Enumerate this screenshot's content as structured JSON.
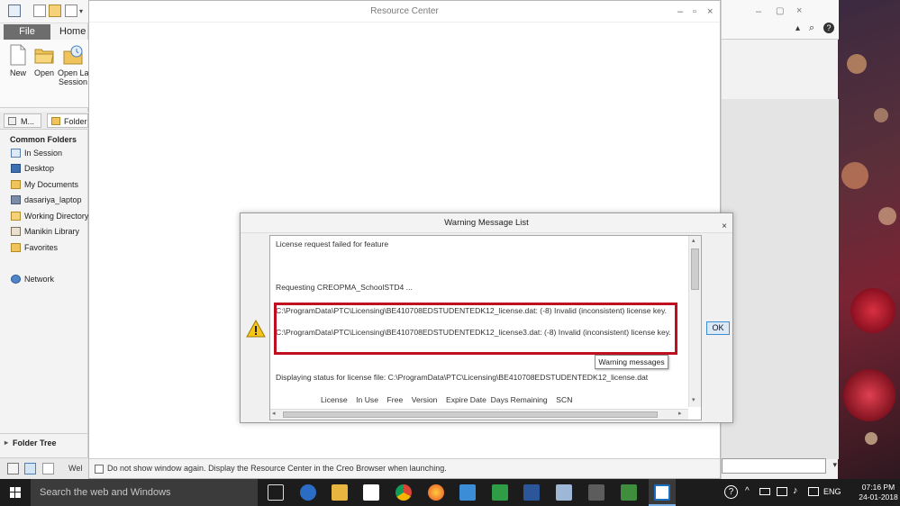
{
  "left_app": {
    "file_tab": "File",
    "home_tab": "Home",
    "ribbon": [
      {
        "label": "New"
      },
      {
        "label": "Open"
      },
      {
        "label": "Open La",
        "label2": "Session"
      }
    ],
    "panel_tabs": [
      "M...",
      "Folder"
    ],
    "common_folders_heading": "Common Folders",
    "folders": [
      "In Session",
      "Desktop",
      "My Documents",
      "dasariya_laptop",
      "Working Directory",
      "Manikin Library",
      "Favorites",
      "Network"
    ],
    "folder_tree_label": "Folder Tree",
    "welcome_tab": "Wel"
  },
  "resource_center": {
    "title": "Resource Center",
    "checkbox_label": "Do not show window again. Display the Resource Center in the Creo Browser when launching."
  },
  "warning_dialog": {
    "title": "Warning Message List",
    "close_glyph": "×",
    "messages": [
      "License request failed for feature",
      "Requesting CREOPMA_SchoolSTD4 ...",
      "C:\\ProgramData\\PTC\\Licensing\\BE410708EDSTUDENTEDK12_license.dat: (-8) Invalid (inconsistent) license key.",
      "C:\\ProgramData\\PTC\\Licensing\\BE410708EDSTUDENTEDK12_license3.dat: (-8) Invalid (inconsistent) license key.",
      "Displaying status for license file: C:\\ProgramData\\PTC\\Licensing\\BE410708EDSTUDENTEDK12_license.dat",
      "License    In Use    Free    Version    Expire Date  Days Remaining    SCN"
    ],
    "tooltip": "Warning messages",
    "ok_label": "OK"
  },
  "taskbar": {
    "search_placeholder": "Search the web and Windows",
    "language": "ENG",
    "time": "07:16 PM",
    "date": "24-01-2018"
  },
  "colors": {
    "highlight_red": "#c0101f",
    "file_tab_gray": "#6d6d6d",
    "taskbar": "#1c1c1c"
  }
}
